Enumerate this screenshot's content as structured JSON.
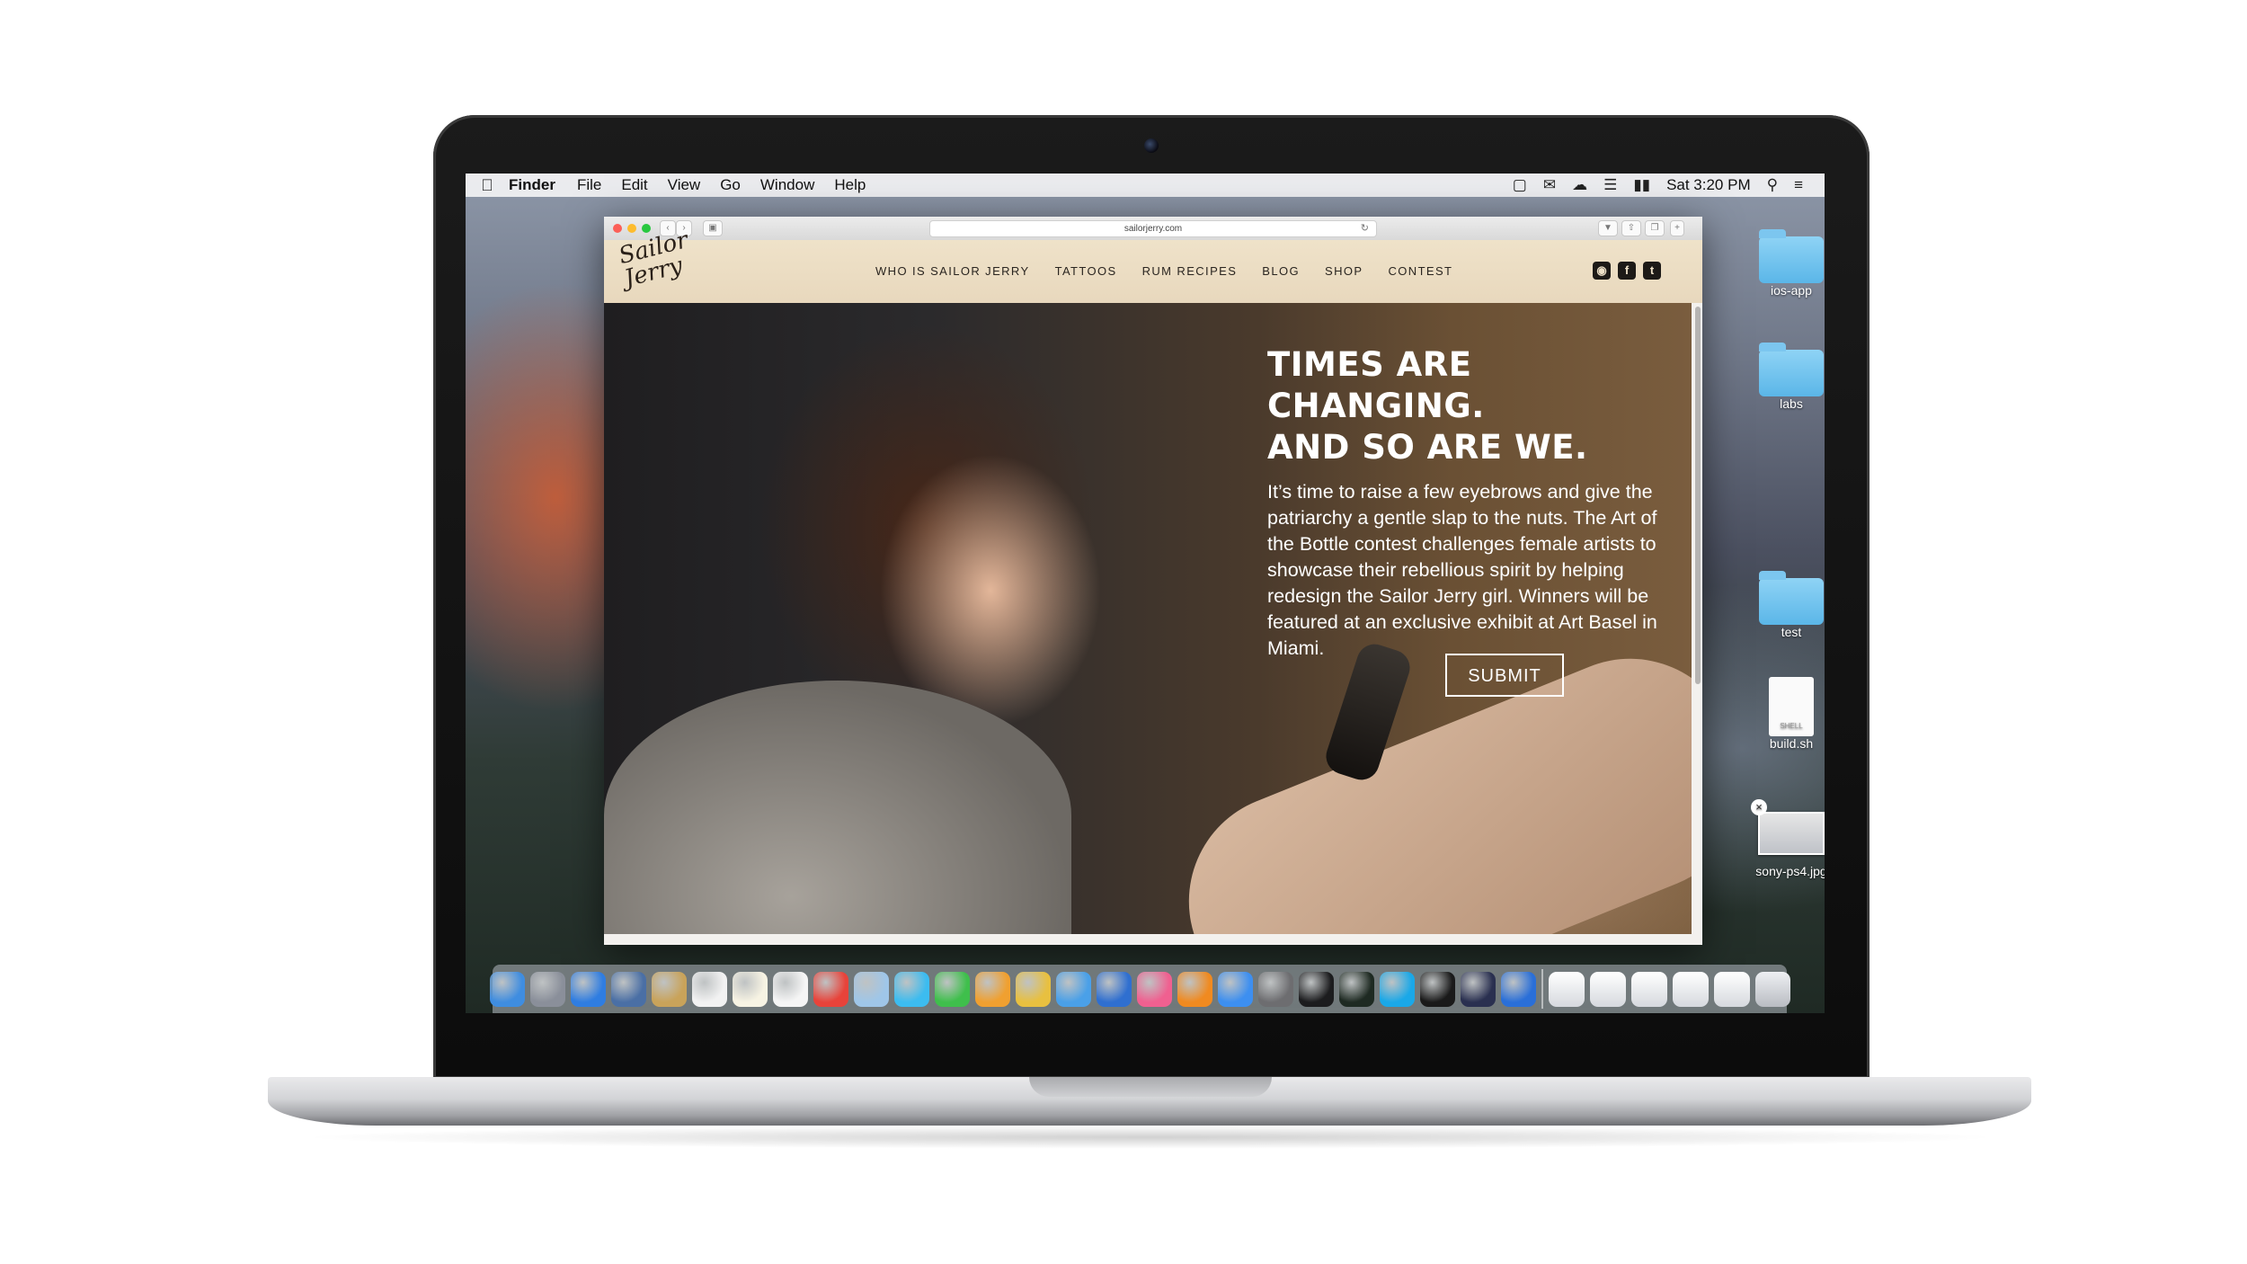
{
  "menubar": {
    "app": "Finder",
    "menus": [
      "File",
      "Edit",
      "View",
      "Go",
      "Window",
      "Help"
    ],
    "clock": "Sat 3:20 PM"
  },
  "browser": {
    "url": "sailorjerry.com"
  },
  "site": {
    "logo_text": "Sailor Jerry",
    "nav": [
      "WHO IS SAILOR JERRY",
      "TATTOOS",
      "RUM RECIPES",
      "BLOG",
      "SHOP",
      "CONTEST"
    ],
    "social": [
      "instagram-icon",
      "facebook-icon",
      "twitter-icon"
    ],
    "hero": {
      "headline_1": "TIMES ARE CHANGING.",
      "headline_2": "AND SO ARE WE.",
      "body": "It’s time to raise a few eyebrows and give the patriarchy a gentle slap to the nuts. The Art of the Bottle contest challenges female artists to showcase their rebellious spirit by helping redesign the Sailor Jerry girl. Winners will be featured at an exclusive exhibit at Art Basel in Miami.",
      "submit_label": "SUBMIT"
    }
  },
  "desktop": {
    "icons": [
      {
        "label": "ios-app",
        "kind": "folder"
      },
      {
        "label": "labs",
        "kind": "folder"
      },
      {
        "label": "test",
        "kind": "folder"
      },
      {
        "label": "build.sh",
        "kind": "file",
        "badge": "SHELL"
      },
      {
        "label": "sony-ps4.jpg",
        "kind": "image"
      }
    ]
  },
  "dock": {
    "app_colors": [
      "#3f8de0",
      "#8a8f9a",
      "#2f7de1",
      "#4a6fa5",
      "#c9a35a",
      "#f2f2f2",
      "#f7f3e3",
      "#f5f5f5",
      "#e8433a",
      "#9fc6e8",
      "#3cbcf0",
      "#3fbf4c",
      "#f0a030",
      "#e8c040",
      "#4aa0e8",
      "#2f6fd0",
      "#f06090",
      "#f08a20",
      "#3d8ff0",
      "#6d6d70",
      "#1c1c1e",
      "#1e2a22",
      "#1aa8e8",
      "#1a1a1a",
      "#2a3050",
      "#2a6fd8"
    ],
    "folder_stack_count": 5,
    "trash": "trash-icon"
  }
}
